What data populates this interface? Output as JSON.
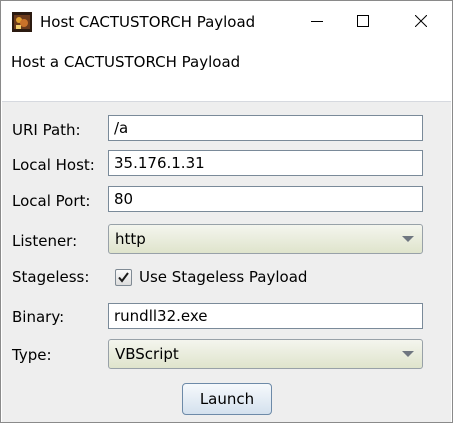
{
  "window": {
    "title": "Host CACTUSTORCH Payload",
    "icon": "cobalt-strike-app-icon"
  },
  "header": {
    "description": "Host a CACTUSTORCH Payload"
  },
  "form": {
    "uri_path": {
      "label": "URI Path:",
      "value": "/a"
    },
    "local_host": {
      "label": "Local Host:",
      "value": "35.176.1.31"
    },
    "local_port": {
      "label": "Local Port:",
      "value": "80"
    },
    "listener": {
      "label": "Listener:",
      "value": "http"
    },
    "stageless": {
      "label": "Stageless:",
      "checkbox_label": "Use Stageless Payload",
      "checked": true
    },
    "binary": {
      "label": "Binary:",
      "value": "rundll32.exe"
    },
    "type": {
      "label": "Type:",
      "value": "VBScript"
    }
  },
  "actions": {
    "launch_label": "Launch"
  },
  "colors": {
    "form_background": "#eeeeee",
    "combo_gradient_top": "#f4f5ee",
    "combo_gradient_bottom": "#dfe4cc",
    "button_gradient_top": "#f6f9fc",
    "button_gradient_bottom": "#d4e1ee"
  }
}
